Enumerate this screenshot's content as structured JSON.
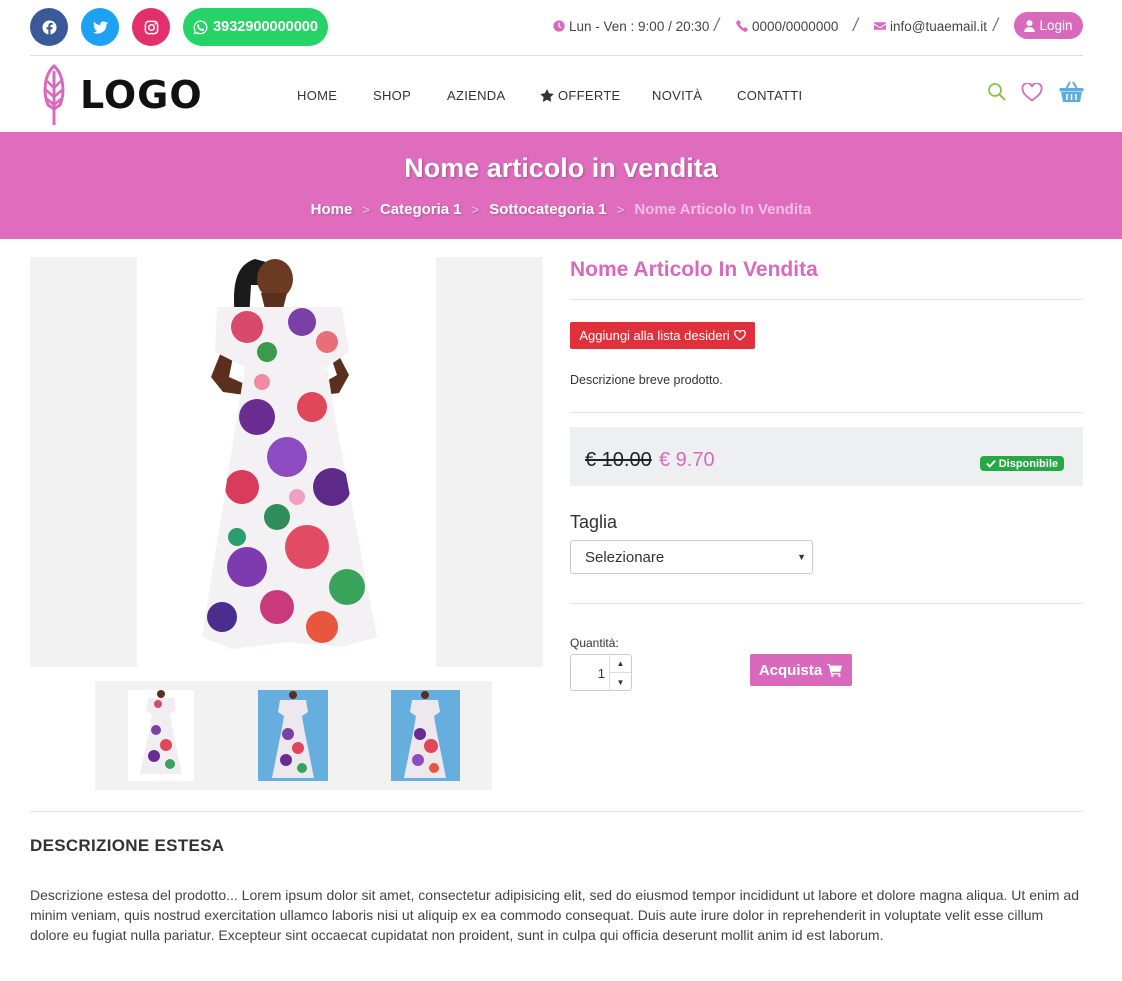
{
  "colors": {
    "accent": "#d969bd",
    "banner": "#df6cbd",
    "facebook": "#3b5998",
    "twitter": "#1da1f2",
    "instagram": "#e1306c",
    "whatsapp": "#25d366",
    "wishlist": "#e0303c",
    "available": "#28a745"
  },
  "topbar": {
    "social": [
      {
        "icon": "facebook-icon"
      },
      {
        "icon": "twitter-icon"
      },
      {
        "icon": "instagram-icon"
      }
    ],
    "whatsapp_number": "3932900000000",
    "hours": "Lun - Ven : 9:00 / 20:30",
    "phone": "0000/0000000",
    "email": "info@tuaemail.it",
    "separator": "/",
    "login_label": "Login"
  },
  "header": {
    "logo_text": "LOGO",
    "nav": [
      "HOME",
      "SHOP",
      "AZIENDA",
      "OFFERTE",
      "NOVITÀ",
      "CONTATTI"
    ]
  },
  "banner": {
    "title": "Nome articolo in vendita",
    "breadcrumb": [
      "Home",
      "Categoria 1",
      "Sottocategoria 1",
      "Nome Articolo In Vendita"
    ],
    "separator": ">"
  },
  "product": {
    "title": "Nome Articolo In Vendita",
    "wishlist_label": "Aggiungi alla lista desideri",
    "short_description": "Descrizione breve prodotto.",
    "old_price": "€ 10.00",
    "new_price": "€ 9.70",
    "availability": "Disponibile",
    "size_label": "Taglia",
    "size_selected": "Selezionare",
    "quantity_label": "Quantità:",
    "quantity": "1",
    "buy_label": "Acquista"
  },
  "description": {
    "title": "DESCRIZIONE ESTESA",
    "text": "Descrizione estesa del prodotto... Lorem ipsum dolor sit amet, consectetur adipisicing elit, sed do eiusmod tempor incididunt ut labore et dolore magna aliqua. Ut enim ad minim veniam, quis nostrud exercitation ullamco laboris nisi ut aliquip ex ea commodo consequat. Duis aute irure dolor in reprehenderit in voluptate velit esse cillum dolore eu fugiat nulla pariatur. Excepteur sint occaecat cupidatat non proident, sunt in culpa qui officia deserunt mollit anim id est laborum."
  }
}
